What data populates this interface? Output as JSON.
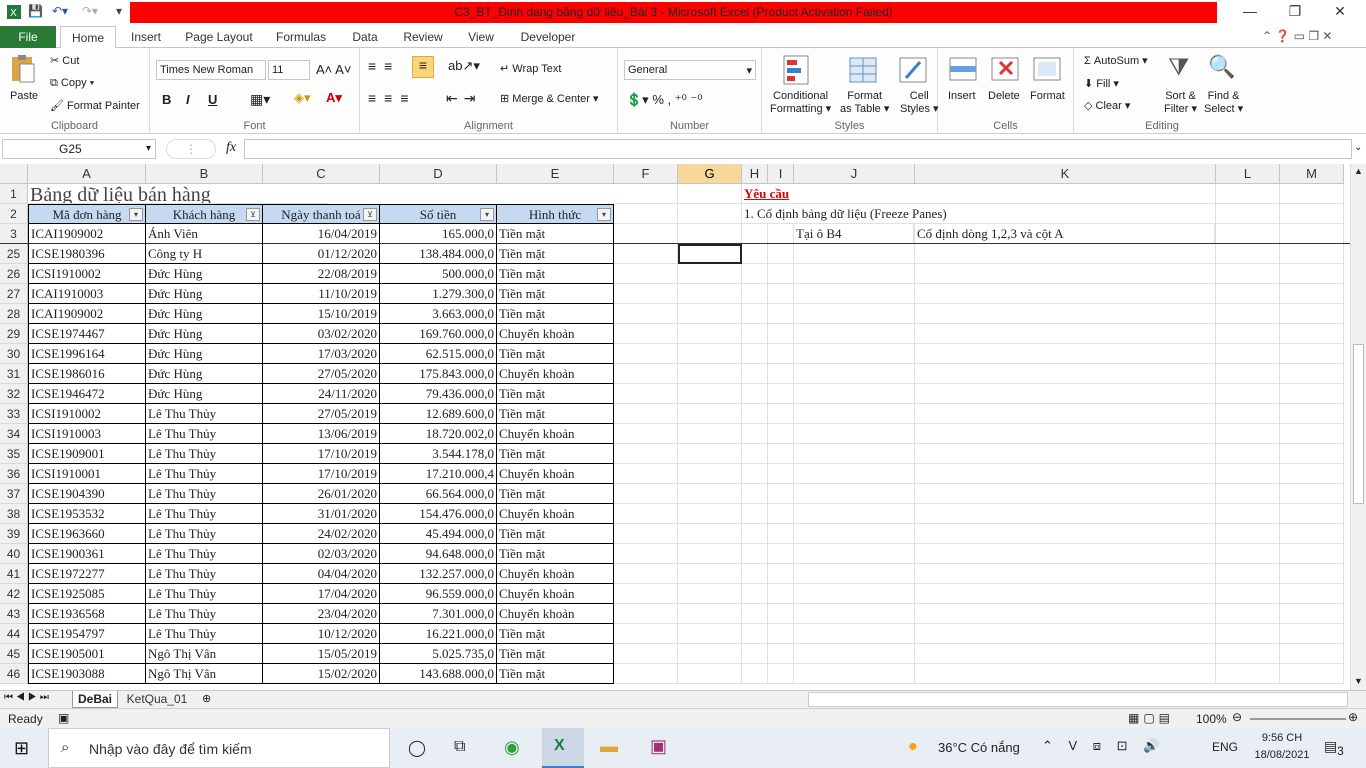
{
  "window": {
    "title": "C3_BT_Định dạng bảng dữ liệu_Bài 3  -  Microsoft Excel (Product Activation Failed)"
  },
  "tabs": {
    "file": "File",
    "items": [
      "Home",
      "Insert",
      "Page Layout",
      "Formulas",
      "Data",
      "Review",
      "View",
      "Developer"
    ],
    "active": "Home"
  },
  "ribbon": {
    "clipboard": {
      "label": "Clipboard",
      "paste": "Paste",
      "cut": "Cut",
      "copy": "Copy",
      "format_painter": "Format Painter"
    },
    "font": {
      "label": "Font",
      "name": "Times New Roman",
      "size": "11",
      "bold": "B",
      "italic": "I",
      "underline": "U"
    },
    "alignment": {
      "label": "Alignment",
      "wrap": "Wrap Text",
      "merge": "Merge & Center"
    },
    "number": {
      "label": "Number",
      "format": "General"
    },
    "styles": {
      "label": "Styles",
      "conditional": "Conditional",
      "conditional2": "Formatting",
      "format_table": "Format",
      "format_table2": "as Table",
      "cell_styles": "Cell",
      "cell_styles2": "Styles"
    },
    "cells": {
      "label": "Cells",
      "insert": "Insert",
      "delete": "Delete",
      "format": "Format"
    },
    "editing": {
      "label": "Editing",
      "autosum": "AutoSum",
      "fill": "Fill",
      "clear": "Clear",
      "sort": "Sort &",
      "sort2": "Filter",
      "find": "Find &",
      "find2": "Select"
    }
  },
  "formula_bar": {
    "name_box": "G25",
    "fx": "fx",
    "value": ""
  },
  "columns": [
    "A",
    "B",
    "C",
    "D",
    "E",
    "F",
    "G",
    "H",
    "I",
    "J",
    "K",
    "L",
    "M"
  ],
  "sheet": {
    "title": "Bảng dữ liệu bán hàng",
    "headers": [
      "Mã đơn hàng",
      "Khách hàng",
      "Ngày thanh toá",
      "Số tiền",
      "Hình thức"
    ],
    "rows": [
      {
        "n": "3",
        "a": "ICAI1909002",
        "b": "Ánh Viên",
        "c": "16/04/2019",
        "d": "165.000,0",
        "e": "Tiền mặt"
      },
      {
        "n": "25",
        "a": "ICSE1980396",
        "b": "Công ty H",
        "c": "01/12/2020",
        "d": "138.484.000,0",
        "e": "Tiền mặt"
      },
      {
        "n": "26",
        "a": "ICSI1910002",
        "b": "Đức Hùng",
        "c": "22/08/2019",
        "d": "500.000,0",
        "e": "Tiền mặt"
      },
      {
        "n": "27",
        "a": "ICAI1910003",
        "b": "Đức Hùng",
        "c": "11/10/2019",
        "d": "1.279.300,0",
        "e": "Tiền mặt"
      },
      {
        "n": "28",
        "a": "ICAI1909002",
        "b": "Đức Hùng",
        "c": "15/10/2019",
        "d": "3.663.000,0",
        "e": "Tiền mặt"
      },
      {
        "n": "29",
        "a": "ICSE1974467",
        "b": "Đức Hùng",
        "c": "03/02/2020",
        "d": "169.760.000,0",
        "e": "Chuyển khoản"
      },
      {
        "n": "30",
        "a": "ICSE1996164",
        "b": "Đức Hùng",
        "c": "17/03/2020",
        "d": "62.515.000,0",
        "e": "Tiền mặt"
      },
      {
        "n": "31",
        "a": "ICSE1986016",
        "b": "Đức Hùng",
        "c": "27/05/2020",
        "d": "175.843.000,0",
        "e": "Chuyển khoản"
      },
      {
        "n": "32",
        "a": "ICSE1946472",
        "b": "Đức Hùng",
        "c": "24/11/2020",
        "d": "79.436.000,0",
        "e": "Tiền mặt"
      },
      {
        "n": "33",
        "a": "ICSI1910002",
        "b": "Lê Thu Thủy",
        "c": "27/05/2019",
        "d": "12.689.600,0",
        "e": "Tiền mặt"
      },
      {
        "n": "34",
        "a": "ICSI1910003",
        "b": "Lê Thu Thủy",
        "c": "13/06/2019",
        "d": "18.720.002,0",
        "e": "Chuyển khoản"
      },
      {
        "n": "35",
        "a": "ICSE1909001",
        "b": "Lê Thu Thủy",
        "c": "17/10/2019",
        "d": "3.544.178,0",
        "e": "Tiền mặt"
      },
      {
        "n": "36",
        "a": "ICSI1910001",
        "b": "Lê Thu Thủy",
        "c": "17/10/2019",
        "d": "17.210.000,4",
        "e": "Chuyển khoản"
      },
      {
        "n": "37",
        "a": "ICSE1904390",
        "b": "Lê Thu Thủy",
        "c": "26/01/2020",
        "d": "66.564.000,0",
        "e": "Tiền mặt"
      },
      {
        "n": "38",
        "a": "ICSE1953532",
        "b": "Lê Thu Thủy",
        "c": "31/01/2020",
        "d": "154.476.000,0",
        "e": "Chuyển khoản"
      },
      {
        "n": "39",
        "a": "ICSE1963660",
        "b": "Lê Thu Thủy",
        "c": "24/02/2020",
        "d": "45.494.000,0",
        "e": "Tiền mặt"
      },
      {
        "n": "40",
        "a": "ICSE1900361",
        "b": "Lê Thu Thủy",
        "c": "02/03/2020",
        "d": "94.648.000,0",
        "e": "Tiền mặt"
      },
      {
        "n": "41",
        "a": "ICSE1972277",
        "b": "Lê Thu Thủy",
        "c": "04/04/2020",
        "d": "132.257.000,0",
        "e": "Chuyển khoản"
      },
      {
        "n": "42",
        "a": "ICSE1925085",
        "b": "Lê Thu Thủy",
        "c": "17/04/2020",
        "d": "96.559.000,0",
        "e": "Chuyển khoản"
      },
      {
        "n": "43",
        "a": "ICSE1936568",
        "b": "Lê Thu Thủy",
        "c": "23/04/2020",
        "d": "7.301.000,0",
        "e": "Chuyển khoản"
      },
      {
        "n": "44",
        "a": "ICSE1954797",
        "b": "Lê Thu Thủy",
        "c": "10/12/2020",
        "d": "16.221.000,0",
        "e": "Tiền mặt"
      },
      {
        "n": "45",
        "a": "ICSE1905001",
        "b": "Ngô Thị Vân",
        "c": "15/05/2019",
        "d": "5.025.735,0",
        "e": "Tiền mặt"
      },
      {
        "n": "46",
        "a": "ICSE1903088",
        "b": "Ngô Thị Vân",
        "c": "15/02/2020",
        "d": "143.688.000,0",
        "e": "Tiền mặt"
      }
    ],
    "req_title": "Yêu cầu",
    "req_1": "1. Cố định bảng dữ liệu (Freeze Panes)",
    "req_cell": "Tại ô B4",
    "req_desc": "Cố định dòng 1,2,3 và cột A"
  },
  "sheet_tabs": [
    "DeBai",
    "KetQua_01"
  ],
  "status": {
    "ready": "Ready",
    "zoom": "100%"
  },
  "taskbar": {
    "search": "Nhập vào đây để tìm kiếm",
    "weather": "36°C  Có nắng",
    "lang": "ENG",
    "time": "9:56 CH",
    "date": "18/08/2021",
    "notif": "3"
  },
  "colors": {
    "accent": "#2a7a35",
    "title_red": "#ff0000",
    "header_fill": "#c5d9f1",
    "selected_col": "#f6d89c"
  }
}
